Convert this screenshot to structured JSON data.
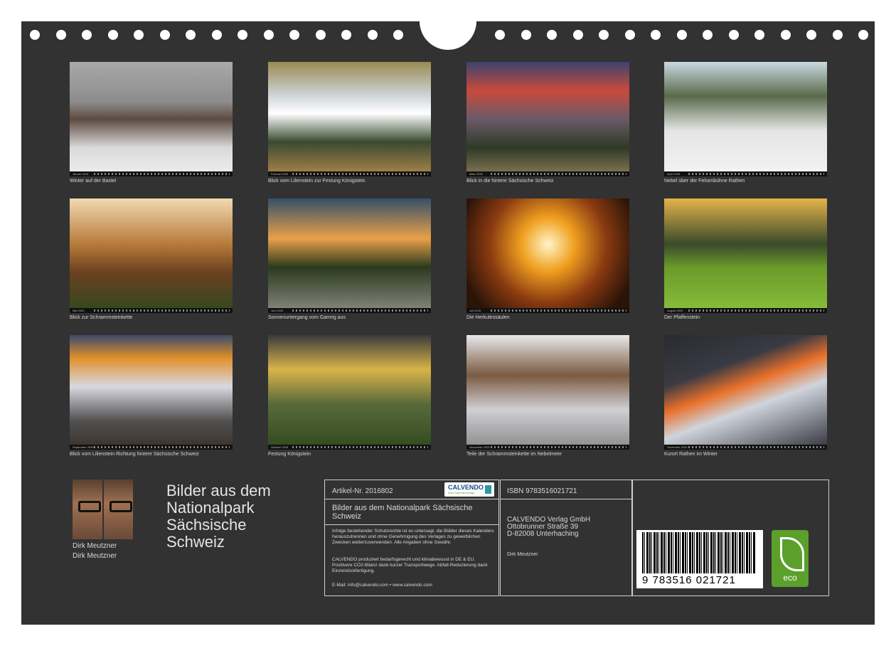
{
  "months": [
    {
      "label": "Januar 2025",
      "caption": "Winter auf der Bastei",
      "tone": "p1"
    },
    {
      "label": "Februar 2025",
      "caption": "Blick vom Lilienstein zur Festung Königstein",
      "tone": "p2"
    },
    {
      "label": "März 2025",
      "caption": "Blick in die hintere Sächsische Schweiz",
      "tone": "p3"
    },
    {
      "label": "April 2025",
      "caption": "Nebel über der Felsenbühne Rathen",
      "tone": "p4"
    },
    {
      "label": "Mai 2025",
      "caption": "Blick zur Schrammsteinkette",
      "tone": "p5"
    },
    {
      "label": "Juni 2025",
      "caption": "Sonnenuntergang vom Gamrig aus",
      "tone": "p6"
    },
    {
      "label": "Juli 2025",
      "caption": "Die Herkulessäulen",
      "tone": "p7"
    },
    {
      "label": "August 2025",
      "caption": "Der Pfaffenstein",
      "tone": "p8"
    },
    {
      "label": "September 2025",
      "caption": "Blick vom Lilienstein Richtung hintere Sächsische Schweiz",
      "tone": "p9"
    },
    {
      "label": "Oktober 2025",
      "caption": "Festung Königstein",
      "tone": "p10"
    },
    {
      "label": "November 2025",
      "caption": "Teile der Schrammsteinkette im Nebelmeer",
      "tone": "p11"
    },
    {
      "label": "Dezember 2025",
      "caption": "Kurort Rathen im Winter",
      "tone": "p12"
    }
  ],
  "author": {
    "name_1": "Dirk Meutzner",
    "name_2": "Dirk Meutzner"
  },
  "title": {
    "line1": "Bilder aus dem",
    "line2": "Nationalpark",
    "line3": "Sächsische",
    "line4": "Schweiz"
  },
  "info": {
    "article": "Artikel-Nr. 2016802",
    "logo_name": "CALVENDO",
    "logo_tag": "Dein Kalenderverlag",
    "product_title": "Bilder aus dem Nationalpark Sächsische Schweiz",
    "legal": "Infolge bestehender Schutzrechte ist es untersagt, die Blätter dieses Kalenders herauszutrennen und ohne Genehmigung des Verlages zu gewerblichen Zwecken weiterzuverwenden. Alle Angaben ohne Gewähr.",
    "eco_note": "CALVENDO produziert bedarfsgerecht und klimabewusst in DE & EU. Positivere CO2-Bilanz dank kurzer Transportwege. Abfall-Reduzierung dank Einzelstückfertigung.",
    "contact": "E-Mail: info@calvendo.com • www.calvendo.com"
  },
  "publisher": {
    "isbn": "ISBN 9783516021721",
    "name": "CALVENDO Verlag GmbH",
    "street": "Ottobrunner Straße 39",
    "city": "D-82008 Unterhaching",
    "author": "Dirk Meutzner"
  },
  "barcode": {
    "digits": "9 783516 021721"
  },
  "eco": {
    "label": "eco"
  }
}
